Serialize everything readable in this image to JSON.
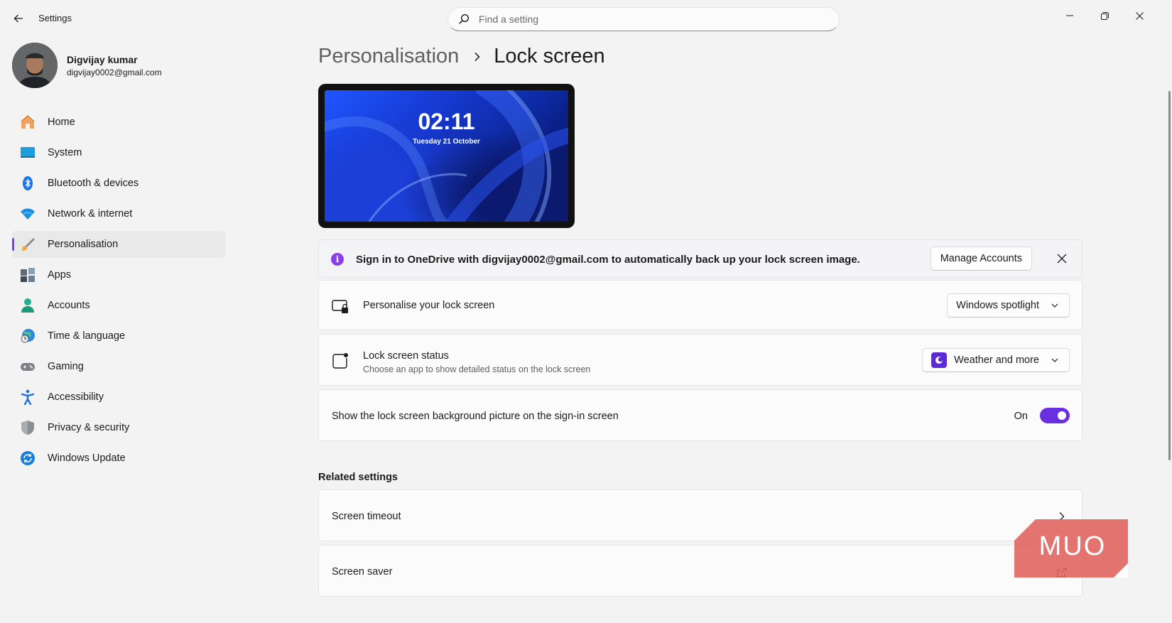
{
  "window": {
    "app_title": "Settings",
    "search_placeholder": "Find a setting"
  },
  "profile": {
    "name": "Digvijay kumar",
    "email": "digvijay0002@gmail.com"
  },
  "sidebar": {
    "items": [
      {
        "label": "Home",
        "icon": "home-icon"
      },
      {
        "label": "System",
        "icon": "system-icon"
      },
      {
        "label": "Bluetooth & devices",
        "icon": "bluetooth-icon"
      },
      {
        "label": "Network & internet",
        "icon": "wifi-icon"
      },
      {
        "label": "Personalisation",
        "icon": "brush-icon",
        "active": true
      },
      {
        "label": "Apps",
        "icon": "apps-icon"
      },
      {
        "label": "Accounts",
        "icon": "accounts-icon"
      },
      {
        "label": "Time & language",
        "icon": "globe-clock-icon"
      },
      {
        "label": "Gaming",
        "icon": "gamepad-icon"
      },
      {
        "label": "Accessibility",
        "icon": "accessibility-icon"
      },
      {
        "label": "Privacy & security",
        "icon": "shield-icon"
      },
      {
        "label": "Windows Update",
        "icon": "update-icon"
      }
    ]
  },
  "breadcrumb": {
    "parent": "Personalisation",
    "current": "Lock screen"
  },
  "preview": {
    "time": "02:11",
    "date": "Tuesday 21 October"
  },
  "info_bar": {
    "icon": "info-icon",
    "text": "Sign in to OneDrive with digvijay0002@gmail.com to automatically back up your lock screen image.",
    "button_label": "Manage Accounts"
  },
  "settings": {
    "personalise": {
      "title": "Personalise your lock screen",
      "value": "Windows spotlight"
    },
    "status": {
      "title": "Lock screen status",
      "subtitle": "Choose an app to show detailed status on the lock screen",
      "value": "Weather and more"
    },
    "signin_bg": {
      "title": "Show the lock screen background picture on the sign-in screen",
      "state_label": "On",
      "enabled": true
    }
  },
  "related": {
    "title": "Related settings",
    "items": [
      {
        "label": "Screen timeout"
      },
      {
        "label": "Screen saver"
      }
    ]
  },
  "watermark": {
    "text": "MUO"
  },
  "colors": {
    "accent": "#6a2fe0",
    "info": "#8a3ee8",
    "watermark": "#e0615b"
  }
}
